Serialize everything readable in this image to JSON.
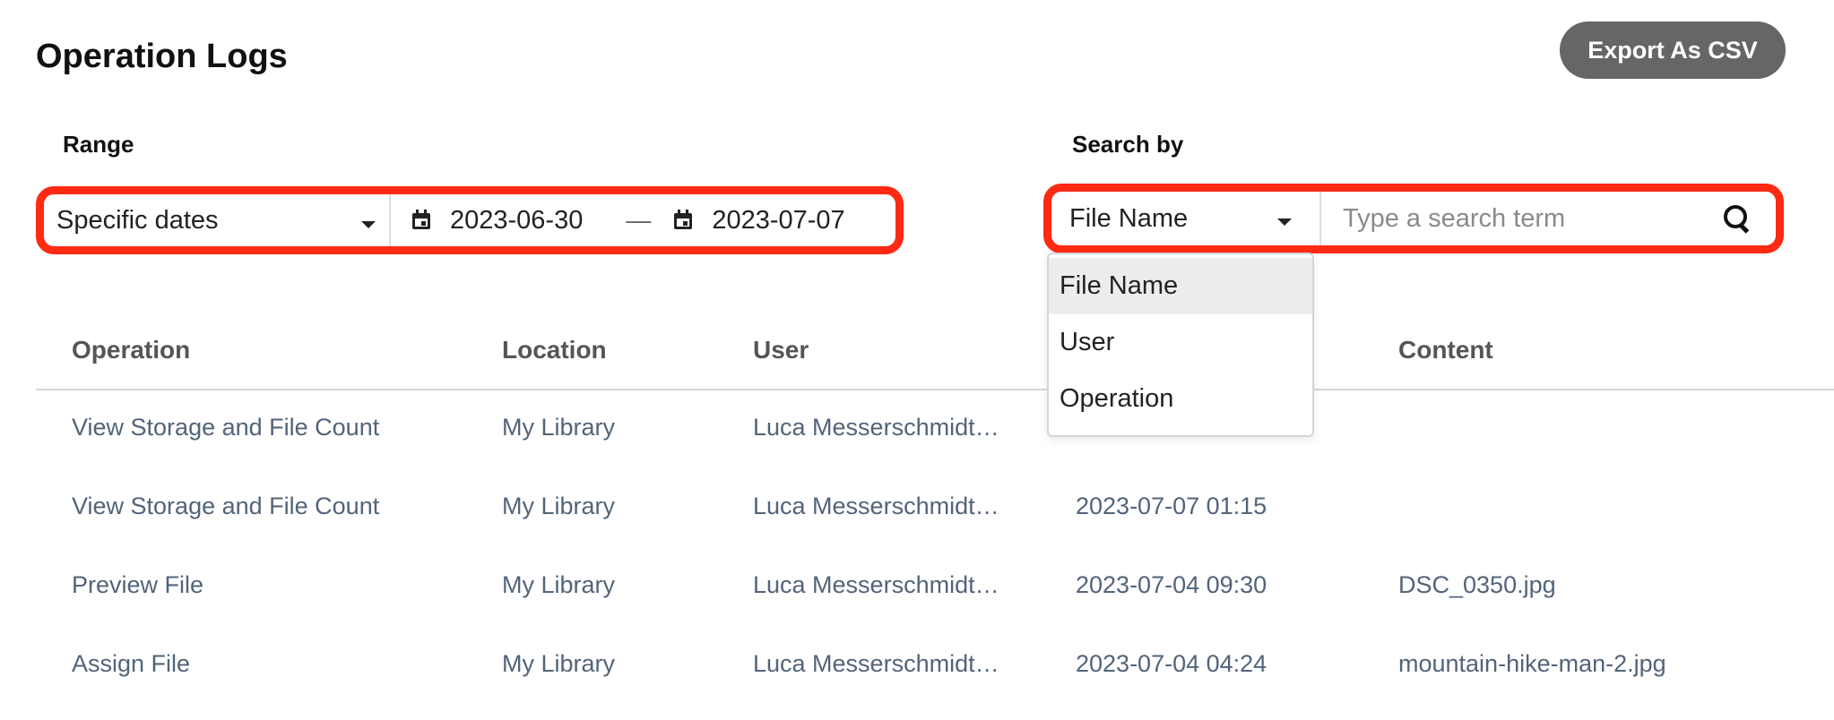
{
  "page": {
    "title": "Operation Logs",
    "export_label": "Export As CSV"
  },
  "range": {
    "label": "Range",
    "selected": "Specific dates",
    "start_date": "2023-06-30",
    "end_date": "2023-07-07",
    "separator": "—"
  },
  "search": {
    "label": "Search by",
    "selected": "File Name",
    "placeholder": "Type a search term",
    "options": [
      "File Name",
      "User",
      "Operation"
    ]
  },
  "table": {
    "columns": [
      "Operation",
      "Location",
      "User",
      "Content"
    ],
    "rows": [
      {
        "operation": "View Storage and File Count",
        "location": "My Library",
        "user": "Luca Messerschmidt…",
        "time": "",
        "content": ""
      },
      {
        "operation": "View Storage and File Count",
        "location": "My Library",
        "user": "Luca Messerschmidt…",
        "time": "2023-07-07 01:15",
        "content": ""
      },
      {
        "operation": "Preview File",
        "location": "My Library",
        "user": "Luca Messerschmidt…",
        "time": "2023-07-04 09:30",
        "content": "DSC_0350.jpg"
      },
      {
        "operation": "Assign File",
        "location": "My Library",
        "user": "Luca Messerschmidt…",
        "time": "2023-07-04 04:24",
        "content": "mountain-hike-man-2.jpg"
      }
    ]
  },
  "colors": {
    "highlight": "#ff2a14",
    "export_button": "#666666",
    "row_text": "#52647a",
    "header_text": "#555555"
  },
  "icons": {
    "range_caret": "chevron-down-icon",
    "date": "calendar-icon",
    "search": "search-icon"
  }
}
